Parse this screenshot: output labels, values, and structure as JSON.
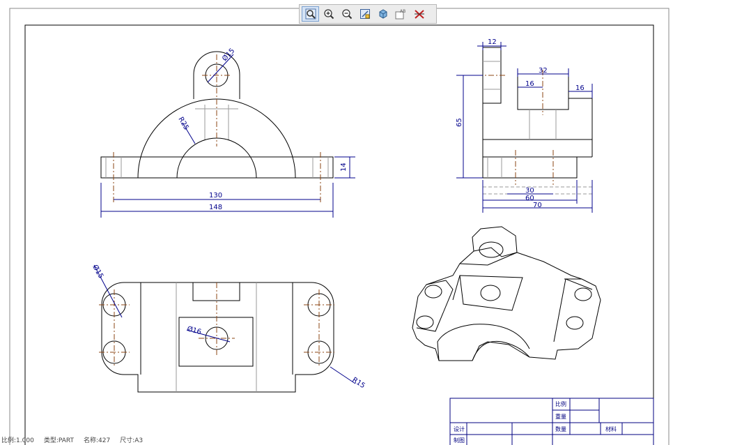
{
  "toolbar": {
    "buttons": [
      {
        "name": "zoom-fit-button",
        "icon": "magnifier-icon"
      },
      {
        "name": "zoom-in-button",
        "icon": "zoom-in-icon"
      },
      {
        "name": "zoom-out-button",
        "icon": "zoom-out-icon"
      },
      {
        "name": "zoom-window-button",
        "icon": "zoom-window-icon"
      },
      {
        "name": "view-3d-button",
        "icon": "cube-icon"
      },
      {
        "name": "annotation-button",
        "icon": "annotation-icon",
        "label": "AB"
      },
      {
        "name": "clear-dimensions-button",
        "icon": "clear-dimensions-icon"
      }
    ]
  },
  "drawing": {
    "front_view": {
      "dim_radius_hole": "Ø15",
      "dim_radius_arch": "R25",
      "dim_height": "14",
      "dim_inner": "130",
      "dim_overall": "148"
    },
    "side_view": {
      "dim_top_width": "12",
      "dim_height": "65",
      "dim_boss": "32",
      "dim_boss_inner": "16",
      "dim_step": "16",
      "dim_30": "30",
      "dim_60": "60",
      "dim_70": "70"
    },
    "top_view": {
      "dim_hole": "Ø15",
      "dim_center": "Ø16",
      "dim_corner": "R15"
    },
    "title_block": {
      "scale_label": "比例",
      "weight_label": "重量",
      "quantity_label": "数量",
      "material_label": "材料",
      "design_label": "设计",
      "draw_label": "制图"
    }
  },
  "status": {
    "scale": "比例:1.000",
    "type": "类型:PART",
    "name": "名称:427",
    "size": "尺寸:A3"
  },
  "colors": {
    "line": "#000000",
    "dimension": "#00008b",
    "centerline": "#8b4513",
    "hidden": "#9a9a9a",
    "frame": "#000080"
  }
}
